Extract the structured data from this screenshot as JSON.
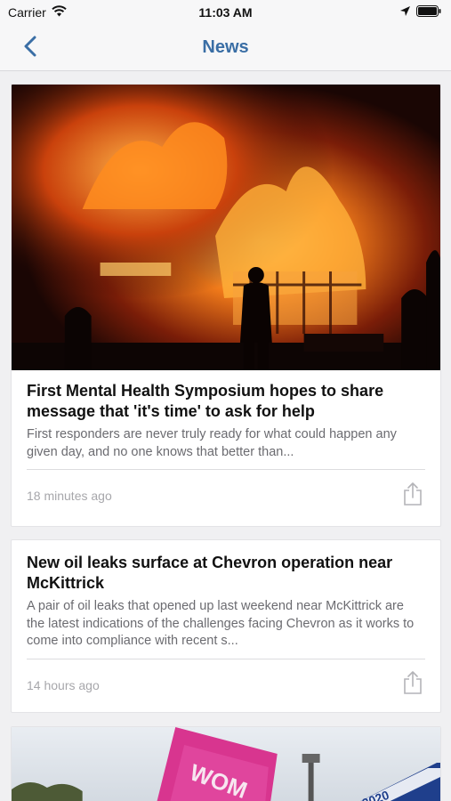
{
  "status_bar": {
    "carrier": "Carrier",
    "time": "11:03 AM"
  },
  "nav": {
    "title": "News",
    "back_icon": "chevron-left-icon"
  },
  "articles": [
    {
      "image": "house-fire-photo",
      "title": "First Mental Health Symposium hopes to share message that 'it's time' to ask for help",
      "summary": "First responders are never truly ready for what could happen any given day, and no one knows that better than...",
      "time": "18 minutes ago",
      "share_icon": "share-icon"
    },
    {
      "title": "New oil leaks surface at Chevron operation near McKittrick",
      "summary": "A pair of oil leaks that opened up last weekend near McKittrick are the latest indications of the challenges facing Chevron as it works to come into compliance with recent s...",
      "time": "14 hours ago",
      "share_icon": "share-icon"
    },
    {
      "image": "protest-flag-photo",
      "image_text": "WOM",
      "image_sign": "2020"
    }
  ],
  "colors": {
    "accent": "#3a6ea5",
    "background": "#f0f0f2",
    "muted_text": "#6b6b70",
    "timestamp": "#a7a7ab"
  }
}
